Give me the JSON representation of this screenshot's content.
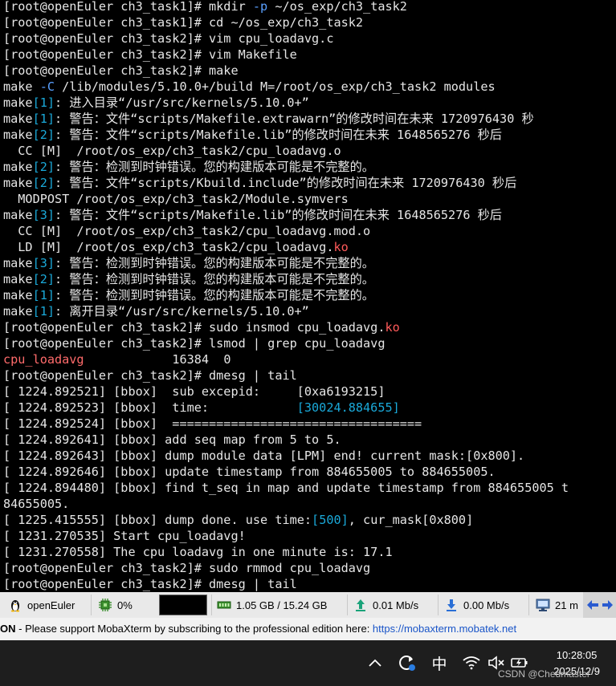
{
  "terminal": {
    "lines": [
      [
        {
          "t": "[root@openEuler ch3_task1]# mkdir "
        },
        {
          "t": "-p",
          "c": "flag"
        },
        {
          "t": " ~/os_exp/ch3_task2"
        }
      ],
      [
        {
          "t": "[root@openEuler ch3_task1]# cd ~/os_exp/ch3_task2"
        }
      ],
      [
        {
          "t": "[root@openEuler ch3_task2]# vim cpu_loadavg.c"
        }
      ],
      [
        {
          "t": "[root@openEuler ch3_task2]# vim Makefile"
        }
      ],
      [
        {
          "t": "[root@openEuler ch3_task2]# make"
        }
      ],
      [
        {
          "t": "make "
        },
        {
          "t": "-C",
          "c": "flag"
        },
        {
          "t": " /lib/modules/5.10.0+/build M=/root/os_exp/ch3_task2 modules"
        }
      ],
      [
        {
          "t": "make"
        },
        {
          "t": "[1]",
          "c": "num"
        },
        {
          "t": ": 进入目录“/usr/src/kernels/5.10.0+”"
        }
      ],
      [
        {
          "t": "make"
        },
        {
          "t": "[1]",
          "c": "num"
        },
        {
          "t": ": 警告：文件“scripts/Makefile.extrawarn”的修改时间在未来 1720976430 秒"
        }
      ],
      [
        {
          "t": "make"
        },
        {
          "t": "[2]",
          "c": "num"
        },
        {
          "t": ": 警告：文件“scripts/Makefile.lib”的修改时间在未来 1648565276 秒后"
        }
      ],
      [
        {
          "t": "  CC [M]  /root/os_exp/ch3_task2/cpu_loadavg.o"
        }
      ],
      [
        {
          "t": "make"
        },
        {
          "t": "[2]",
          "c": "num"
        },
        {
          "t": ": 警告：检测到时钟错误。您的构建版本可能是不完整的。"
        }
      ],
      [
        {
          "t": "make"
        },
        {
          "t": "[2]",
          "c": "num"
        },
        {
          "t": ": 警告：文件“scripts/Kbuild.include”的修改时间在未来 1720976430 秒后"
        }
      ],
      [
        {
          "t": "  MODPOST /root/os_exp/ch3_task2/Module.symvers"
        }
      ],
      [
        {
          "t": "make"
        },
        {
          "t": "[3]",
          "c": "num"
        },
        {
          "t": ": 警告：文件“scripts/Makefile.lib”的修改时间在未来 1648565276 秒后"
        }
      ],
      [
        {
          "t": "  CC [M]  /root/os_exp/ch3_task2/cpu_loadavg.mod.o"
        }
      ],
      [
        {
          "t": "  LD [M]  /root/os_exp/ch3_task2/cpu_loadavg."
        },
        {
          "t": "ko",
          "c": "ko"
        }
      ],
      [
        {
          "t": "make"
        },
        {
          "t": "[3]",
          "c": "num"
        },
        {
          "t": ": 警告：检测到时钟错误。您的构建版本可能是不完整的。"
        }
      ],
      [
        {
          "t": "make"
        },
        {
          "t": "[2]",
          "c": "num"
        },
        {
          "t": ": 警告：检测到时钟错误。您的构建版本可能是不完整的。"
        }
      ],
      [
        {
          "t": "make"
        },
        {
          "t": "[1]",
          "c": "num"
        },
        {
          "t": ": 警告：检测到时钟错误。您的构建版本可能是不完整的。"
        }
      ],
      [
        {
          "t": "make"
        },
        {
          "t": "[1]",
          "c": "num"
        },
        {
          "t": ": 离开目录“/usr/src/kernels/5.10.0+”"
        }
      ],
      [
        {
          "t": "[root@openEuler ch3_task2]# sudo insmod cpu_loadavg."
        },
        {
          "t": "ko",
          "c": "ko"
        }
      ],
      [
        {
          "t": "[root@openEuler ch3_task2]# lsmod | grep cpu_loadavg"
        }
      ],
      [
        {
          "t": "cpu_loadavg",
          "c": "mod"
        },
        {
          "t": "            16384  0"
        }
      ],
      [
        {
          "t": "[root@openEuler ch3_task2]# dmesg | tail"
        }
      ],
      [
        {
          "t": "[ 1224.892521] [bbox]  sub excepid:     [0xa6193215]"
        }
      ],
      [
        {
          "t": "[ 1224.892523] [bbox]  time:            "
        },
        {
          "t": "[30024.884655]",
          "c": "num"
        }
      ],
      [
        {
          "t": "[ 1224.892524] [bbox]  =================================="
        }
      ],
      [
        {
          "t": "[ 1224.892641] [bbox] add seq map from 5 to 5."
        }
      ],
      [
        {
          "t": "[ 1224.892643] [bbox] dump module data [LPM] end! current mask:[0x800]."
        }
      ],
      [
        {
          "t": "[ 1224.892646] [bbox] update timestamp from 884655005 to 884655005."
        }
      ],
      [
        {
          "t": "[ 1224.894480] [bbox] find t_seq in map and update timestamp from 884655005 t"
        }
      ],
      [
        {
          "t": "84655005."
        }
      ],
      [
        {
          "t": "[ 1225.415555] [bbox] dump done. use time:"
        },
        {
          "t": "[500]",
          "c": "num"
        },
        {
          "t": ", cur_mask[0x800]"
        }
      ],
      [
        {
          "t": "[ 1231.270535] Start cpu_loadavg!"
        }
      ],
      [
        {
          "t": "[ 1231.270558] The cpu loadavg in one minute is: 17.1"
        }
      ],
      [
        {
          "t": "[root@openEuler ch3_task2]# sudo rmmod cpu_loadavg"
        }
      ],
      [
        {
          "t": "[root@openEuler ch3_task2]# dmesg | tail"
        }
      ]
    ]
  },
  "statusbar": {
    "os_name": "openEuler",
    "cpu": "0%",
    "memory": "1.05 GB / 15.24 GB",
    "upload": "0.01 Mb/s",
    "download": "0.00 Mb/s",
    "uptime": "21 m"
  },
  "adbar": {
    "brand": "ON",
    "separator": " - ",
    "message": "Please support MobaXterm by subscribing to the professional edition here: ",
    "link": "https://mobaxterm.mobatek.net"
  },
  "taskbar": {
    "ime_label": "中",
    "time": "10:28:05",
    "date": "2025/12/9",
    "watermark": "CSDN @Chedmaster"
  },
  "colors": {
    "flag": "#5aa0ff",
    "num": "#1aa9d9",
    "ko": "#ff5a5a",
    "module": "#ff6b6b"
  }
}
